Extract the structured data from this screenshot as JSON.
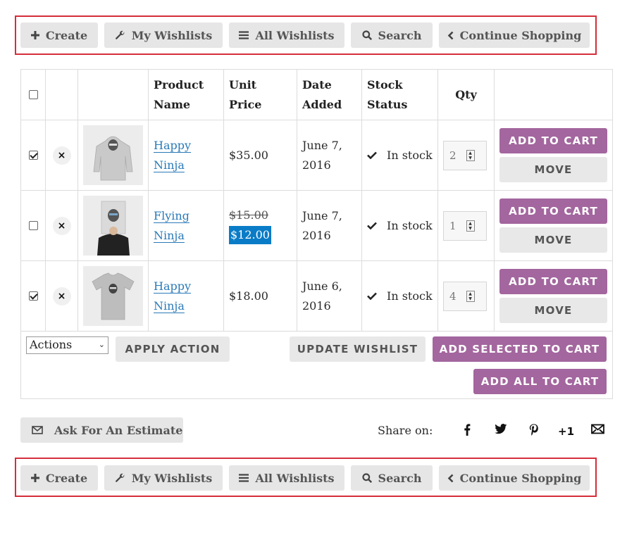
{
  "nav": {
    "create": "Create",
    "my_wishlists": "My Wishlists",
    "all_wishlists": "All Wishlists",
    "search": "Search",
    "continue_shopping": "Continue Shopping"
  },
  "table": {
    "headers": {
      "product_name": "Product Name",
      "unit_price": "Unit Price",
      "date_added": "Date Added",
      "stock_status": "Stock Status",
      "qty": "Qty"
    },
    "rows": [
      {
        "checked": true,
        "name": "Happy Ninja",
        "price": "$35.00",
        "date": "June 7, 2016",
        "stock": "In stock",
        "qty": "2",
        "add": "ADD TO CART",
        "move": "MOVE"
      },
      {
        "checked": false,
        "name": "Flying Ninja",
        "old_price": "$15.00",
        "price": "$12.00",
        "date": "June 7, 2016",
        "stock": "In stock",
        "qty": "1",
        "add": "ADD TO CART",
        "move": "MOVE"
      },
      {
        "checked": true,
        "name": "Happy Ninja",
        "price": "$18.00",
        "date": "June 6, 2016",
        "stock": "In stock",
        "qty": "4",
        "add": "ADD TO CART",
        "move": "MOVE"
      }
    ],
    "remove_glyph": "×"
  },
  "footer_actions": {
    "select_value": "Actions",
    "apply_action": "APPLY ACTION",
    "update_wishlist": "UPDATE WISHLIST",
    "add_selected": "ADD SELECTED TO CART",
    "add_all": "ADD ALL TO CART"
  },
  "estimate": {
    "label": "Ask For An Estimate"
  },
  "share": {
    "label": "Share on:",
    "gplus": "+1"
  },
  "colors": {
    "accent": "#a3669e",
    "link": "#2a7ab8",
    "sale": "#0a7cc7",
    "highlight_border": "#d52e3a"
  }
}
